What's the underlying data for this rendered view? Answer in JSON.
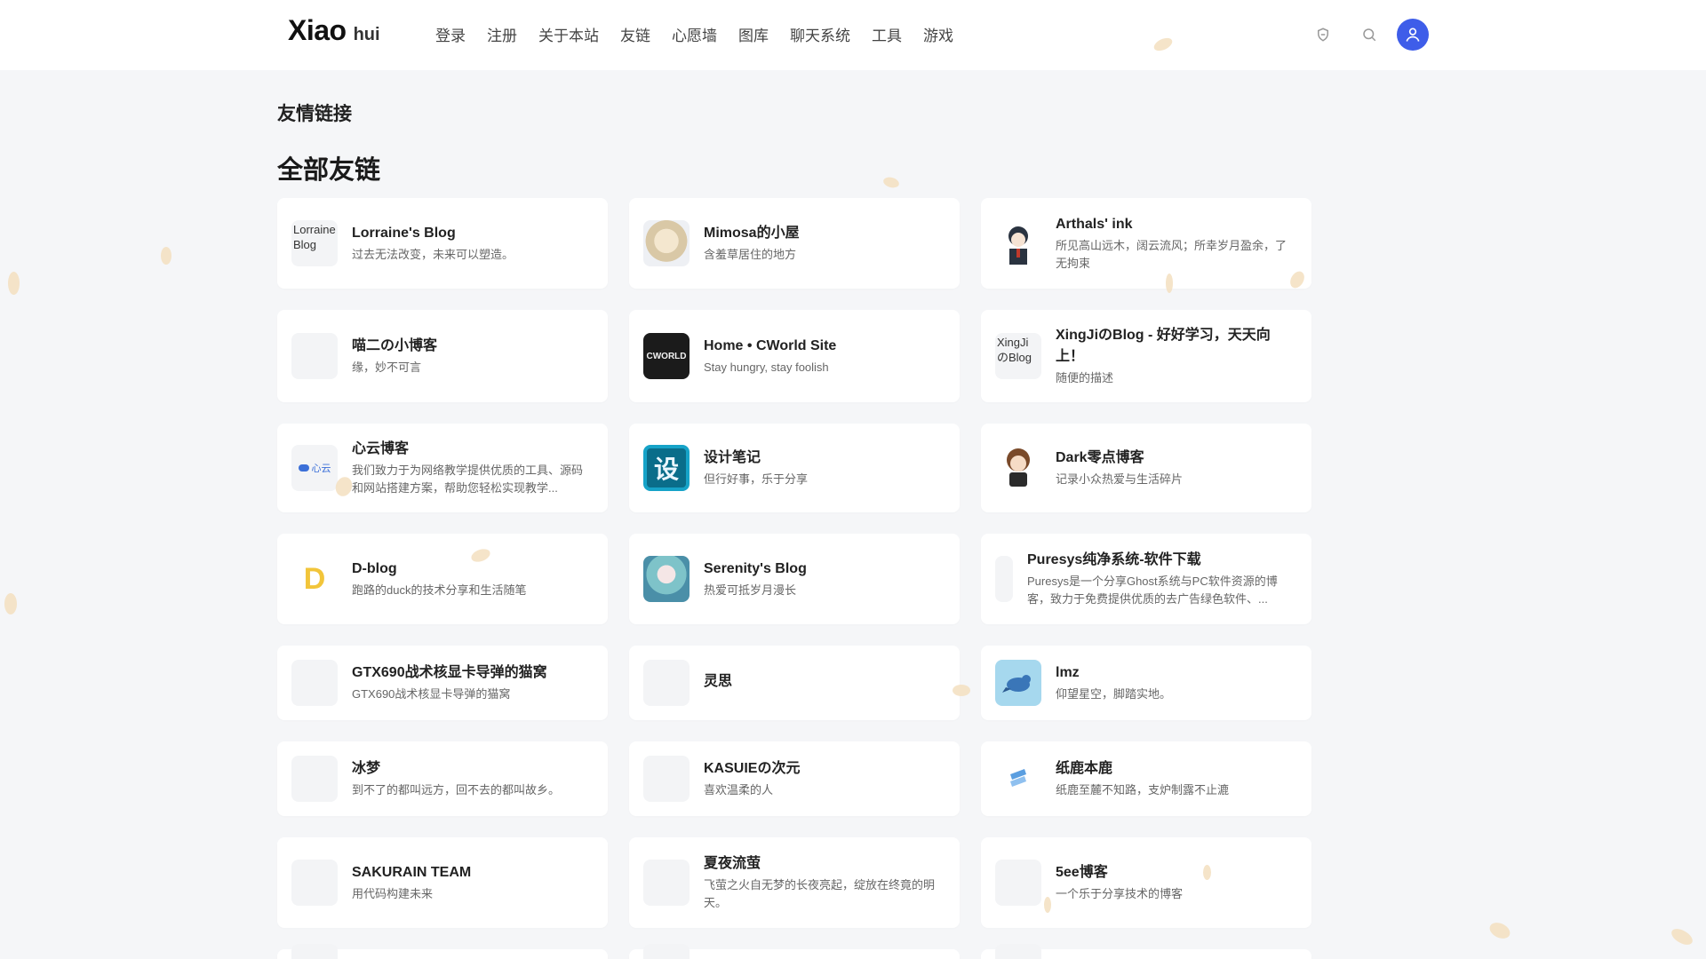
{
  "header": {
    "logo_main": "Xiao",
    "logo_sub": "hui",
    "nav": [
      "登录",
      "注册",
      "关于本站",
      "友链",
      "心愿墙",
      "图库",
      "聊天系统",
      "工具",
      "游戏"
    ]
  },
  "page": {
    "breadcrumb": "友情链接",
    "section_title": "全部友链"
  },
  "links": [
    {
      "name": "Lorraine's Blog",
      "desc": "过去无法改变，未来可以塑造。",
      "avatar_alt": "Lorraine Blog",
      "avatar": "broken"
    },
    {
      "name": "Mimosa的小屋",
      "desc": "含羞草居住的地方",
      "avatar": "anime-girl"
    },
    {
      "name": "Arthals' ink",
      "desc": "所见高山远木，阔云流风；所幸岁月盈余，了无拘束",
      "avatar": "anime-boy"
    },
    {
      "name": "喵二の小博客",
      "desc": "缘，妙不可言",
      "avatar": "blank"
    },
    {
      "name": "Home • CWorld Site",
      "desc": "Stay hungry, stay foolish",
      "avatar": "cworld",
      "avatar_text": "CWORLD"
    },
    {
      "name": "XingJiのBlog - 好好学习，天天向上！",
      "desc": "随便的描述",
      "avatar_alt": "XingJiのBlog",
      "avatar": "broken"
    },
    {
      "name": "心云博客",
      "desc": "我们致力于为网络教学提供优质的工具、源码和网站搭建方案，帮助您轻松实现教学...",
      "avatar": "xinyun",
      "avatar_text": "心云"
    },
    {
      "name": "设计笔记",
      "desc": "但行好事，乐于分享",
      "avatar": "sheji",
      "avatar_text": "设"
    },
    {
      "name": "Dark零点博客",
      "desc": "记录小众热爱与生活碎片",
      "avatar": "chibi"
    },
    {
      "name": "D-blog",
      "desc": "跑路的duck的技术分享和生活随笔",
      "avatar": "dblog",
      "avatar_text": "D"
    },
    {
      "name": "Serenity's Blog",
      "desc": "热爱可抵岁月漫长",
      "avatar": "miku"
    },
    {
      "name": "Puresys纯净系统-软件下载",
      "desc": "Puresys是一个分享Ghost系统与PC软件资源的博客，致力于免费提供优质的去广告绿色软件、...",
      "avatar": "thin"
    },
    {
      "name": "GTX690战术核显卡导弹的猫窝",
      "desc": "GTX690战术核显卡导弹的猫窝",
      "avatar": "blank"
    },
    {
      "name": "灵思",
      "desc": "",
      "avatar": "blank"
    },
    {
      "name": "lmz",
      "desc": "仰望星空，脚踏实地。",
      "avatar": "bird"
    },
    {
      "name": "冰梦",
      "desc": "到不了的都叫远方，回不去的都叫故乡。",
      "avatar": "blank"
    },
    {
      "name": "KASUIEの次元",
      "desc": "喜欢温柔的人",
      "avatar": "blank"
    },
    {
      "name": "纸鹿本鹿",
      "desc": "纸鹿至麓不知路，支炉制露不止漉",
      "avatar": "paper"
    },
    {
      "name": "SAKURAIN TEAM",
      "desc": "用代码构建未来",
      "avatar": "blank"
    },
    {
      "name": "夏夜流萤",
      "desc": "飞萤之火自无梦的长夜亮起，绽放在终竟的明天。",
      "avatar": "blank"
    },
    {
      "name": "5ee博客",
      "desc": "一个乐于分享技术的博客",
      "avatar": "blank"
    },
    {
      "name": "",
      "desc": "",
      "avatar": "blank"
    },
    {
      "name": "",
      "desc": "",
      "avatar": "blank"
    },
    {
      "name": "",
      "desc": "",
      "avatar": "blank"
    }
  ],
  "colors": {
    "accent": "#3e5de9",
    "background": "#f5f6f8",
    "card": "#ffffff",
    "petal": "#f3dfbf"
  },
  "icons": [
    "shield-icon",
    "search-icon",
    "user-icon"
  ]
}
